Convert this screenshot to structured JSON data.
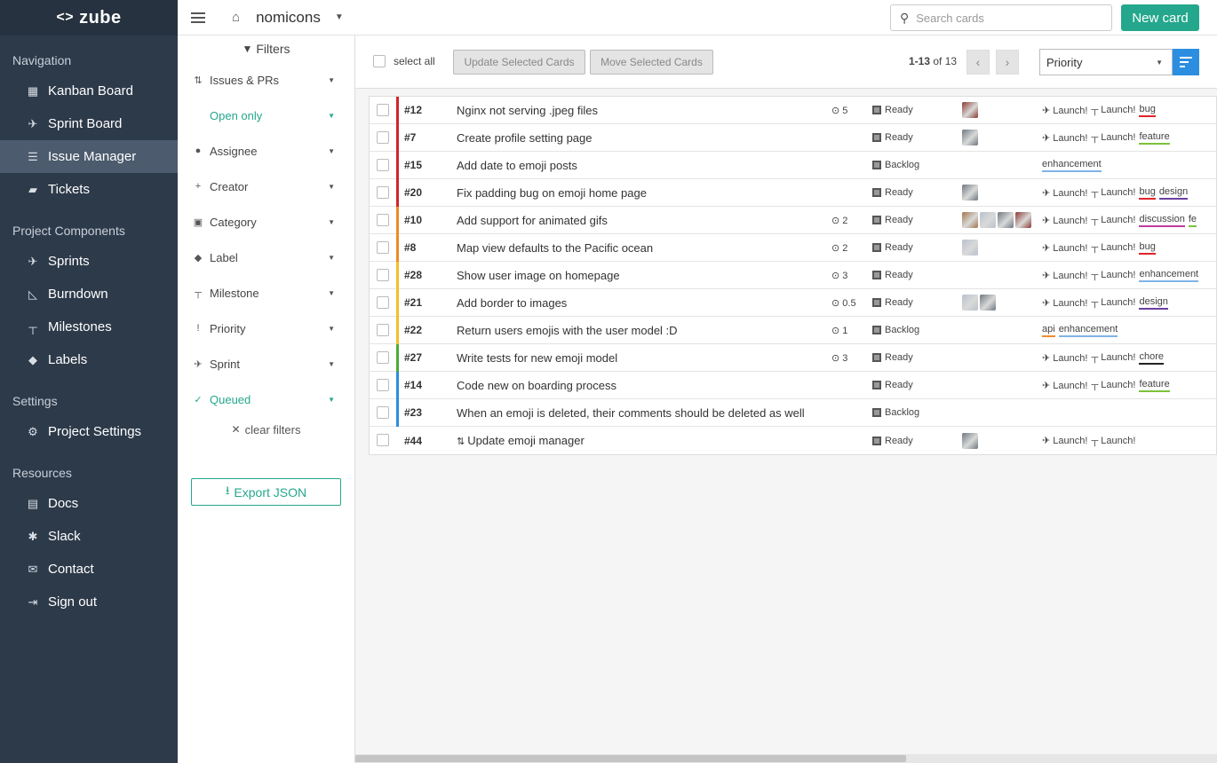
{
  "app": {
    "logo_text": "zube"
  },
  "sidebar": {
    "sections": [
      {
        "title": "Navigation",
        "items": [
          {
            "label": "Kanban Board",
            "icon": "grid-icon",
            "active": false
          },
          {
            "label": "Sprint Board",
            "icon": "runner-icon",
            "active": false
          },
          {
            "label": "Issue Manager",
            "icon": "list-icon",
            "active": true
          },
          {
            "label": "Tickets",
            "icon": "ticket-icon",
            "active": false
          }
        ]
      },
      {
        "title": "Project Components",
        "items": [
          {
            "label": "Sprints",
            "icon": "runner-icon"
          },
          {
            "label": "Burndown",
            "icon": "chart-icon"
          },
          {
            "label": "Milestones",
            "icon": "signpost-icon"
          },
          {
            "label": "Labels",
            "icon": "tag-icon"
          }
        ]
      },
      {
        "title": "Settings",
        "items": [
          {
            "label": "Project Settings",
            "icon": "gear-icon"
          }
        ]
      },
      {
        "title": "Resources",
        "items": [
          {
            "label": "Docs",
            "icon": "docs-icon"
          },
          {
            "label": "Slack",
            "icon": "slack-icon"
          },
          {
            "label": "Contact",
            "icon": "mail-icon"
          },
          {
            "label": "Sign out",
            "icon": "signout-icon"
          }
        ]
      }
    ]
  },
  "topbar": {
    "project_name": "nomicons",
    "search_placeholder": "Search cards",
    "new_card_label": "New card"
  },
  "filters": {
    "title": "Filters",
    "items": [
      {
        "label": "Issues & PRs",
        "icon": "pr-icon",
        "active": false
      },
      {
        "label": "Open only",
        "icon": "",
        "active": true
      },
      {
        "label": "Assignee",
        "icon": "person-icon",
        "active": false
      },
      {
        "label": "Creator",
        "icon": "person-add-icon",
        "active": false
      },
      {
        "label": "Category",
        "icon": "category-icon",
        "active": false
      },
      {
        "label": "Label",
        "icon": "tag-icon",
        "active": false
      },
      {
        "label": "Milestone",
        "icon": "signpost-icon",
        "active": false
      },
      {
        "label": "Priority",
        "icon": "exclamation-icon",
        "active": false
      },
      {
        "label": "Sprint",
        "icon": "runner-icon",
        "active": false
      },
      {
        "label": "Queued",
        "icon": "check-icon",
        "active": true
      }
    ],
    "clear_label": "clear filters",
    "export_label": "Export JSON"
  },
  "toolbar": {
    "select_all_label": "select all",
    "update_label": "Update Selected Cards",
    "move_label": "Move Selected Cards",
    "page_range": "1-13",
    "page_of": "of 13",
    "sort_value": "Priority"
  },
  "colors": {
    "accent": "#24a78c",
    "sidebar_bg": "#2d3a4a",
    "sort_button": "#2b8ee0"
  },
  "cards": [
    {
      "num": "#12",
      "title": "Nginx not serving .jpeg files",
      "points": "5",
      "status": "Ready",
      "priority_color": "#d0252b",
      "avatars": [
        "#8a3a30"
      ],
      "sprint": "Launch!",
      "milestone": "Launch!",
      "labels": [
        {
          "name": "bug",
          "color": "#e0242b"
        }
      ]
    },
    {
      "num": "#7",
      "title": "Create profile setting page",
      "points": "",
      "status": "Ready",
      "priority_color": "#d0252b",
      "avatars": [
        "#6e7880"
      ],
      "sprint": "Launch!",
      "milestone": "Launch!",
      "labels": [
        {
          "name": "feature",
          "color": "#7cc23a"
        }
      ]
    },
    {
      "num": "#15",
      "title": "Add date to emoji posts",
      "points": "",
      "status": "Backlog",
      "priority_color": "#d0252b",
      "avatars": [],
      "sprint": "",
      "milestone": "",
      "labels": [
        {
          "name": "enhancement",
          "color": "#7fb4e8"
        }
      ]
    },
    {
      "num": "#20",
      "title": "Fix padding bug on emoji home page",
      "points": "",
      "status": "Ready",
      "priority_color": "#d0252b",
      "avatars": [
        "#6e7880"
      ],
      "sprint": "Launch!",
      "milestone": "Launch!",
      "labels": [
        {
          "name": "bug",
          "color": "#e0242b"
        },
        {
          "name": "design",
          "color": "#6b3fa0"
        }
      ]
    },
    {
      "num": "#10",
      "title": "Add support for animated gifs",
      "points": "2",
      "status": "Ready",
      "priority_color": "#ee8a2a",
      "avatars": [
        "#a0764a",
        "#b9c2cc",
        "#6e7880",
        "#8a3a30"
      ],
      "sprint": "Launch!",
      "milestone": "Launch!",
      "labels": [
        {
          "name": "discussion",
          "color": "#c23aa0"
        },
        {
          "name": "fe",
          "color": "#7cc23a"
        }
      ]
    },
    {
      "num": "#8",
      "title": "Map view defaults to the Pacific ocean",
      "points": "2",
      "status": "Ready",
      "priority_color": "#ee8a2a",
      "avatars": [
        "#b9c2cc"
      ],
      "sprint": "Launch!",
      "milestone": "Launch!",
      "labels": [
        {
          "name": "bug",
          "color": "#e0242b"
        }
      ]
    },
    {
      "num": "#28",
      "title": "Show user image on homepage",
      "points": "3",
      "status": "Ready",
      "priority_color": "#f3c02b",
      "avatars": [],
      "sprint": "Launch!",
      "milestone": "Launch!",
      "labels": [
        {
          "name": "enhancement",
          "color": "#7fb4e8"
        }
      ]
    },
    {
      "num": "#21",
      "title": "Add border to images",
      "points": "0.5",
      "status": "Ready",
      "priority_color": "#f3c02b",
      "avatars": [
        "#b9c2cc",
        "#6e7880"
      ],
      "sprint": "Launch!",
      "milestone": "Launch!",
      "labels": [
        {
          "name": "design",
          "color": "#6b3fa0"
        }
      ]
    },
    {
      "num": "#22",
      "title": "Return users emojis with the user model :D",
      "points": "1",
      "status": "Backlog",
      "priority_color": "#f3c02b",
      "avatars": [],
      "sprint": "",
      "milestone": "",
      "labels": [
        {
          "name": "api",
          "color": "#ee8a2a"
        },
        {
          "name": "enhancement",
          "color": "#7fb4e8"
        }
      ]
    },
    {
      "num": "#27",
      "title": "Write tests for new emoji model",
      "points": "3",
      "status": "Ready",
      "priority_color": "#4caa3a",
      "avatars": [],
      "sprint": "Launch!",
      "milestone": "Launch!",
      "labels": [
        {
          "name": "chore",
          "color": "#222222"
        }
      ]
    },
    {
      "num": "#14",
      "title": "Code new on boarding process",
      "points": "",
      "status": "Ready",
      "priority_color": "#2b8ee0",
      "avatars": [],
      "sprint": "Launch!",
      "milestone": "Launch!",
      "labels": [
        {
          "name": "feature",
          "color": "#7cc23a"
        }
      ]
    },
    {
      "num": "#23",
      "title": "When an emoji is deleted, their comments should be deleted as well",
      "points": "",
      "status": "Backlog",
      "priority_color": "#2b8ee0",
      "avatars": [],
      "sprint": "",
      "milestone": "",
      "labels": []
    },
    {
      "num": "#44",
      "title": "Update emoji manager",
      "is_pr": true,
      "points": "",
      "status": "Ready",
      "priority_color": "",
      "avatars": [
        "#6e7880"
      ],
      "sprint": "Launch!",
      "milestone": "Launch!",
      "labels": []
    }
  ]
}
